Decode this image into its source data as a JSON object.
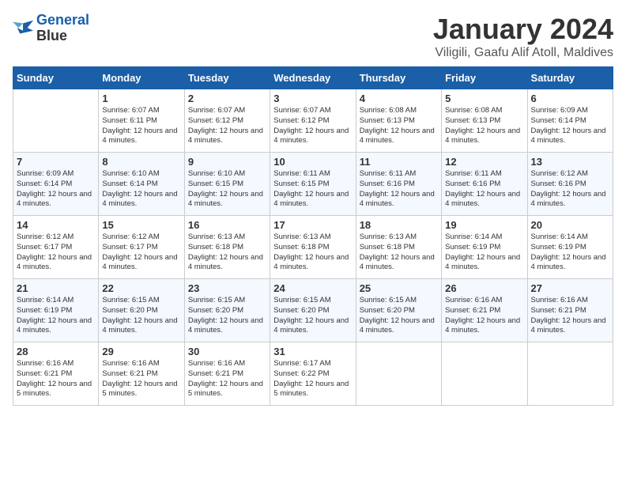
{
  "header": {
    "logo_line1": "General",
    "logo_line2": "Blue",
    "month": "January 2024",
    "location": "Viligili, Gaafu Alif Atoll, Maldives"
  },
  "days_of_week": [
    "Sunday",
    "Monday",
    "Tuesday",
    "Wednesday",
    "Thursday",
    "Friday",
    "Saturday"
  ],
  "weeks": [
    [
      {
        "day": "",
        "sunrise": "",
        "sunset": "",
        "daylight": ""
      },
      {
        "day": "1",
        "sunrise": "Sunrise: 6:07 AM",
        "sunset": "Sunset: 6:11 PM",
        "daylight": "Daylight: 12 hours and 4 minutes."
      },
      {
        "day": "2",
        "sunrise": "Sunrise: 6:07 AM",
        "sunset": "Sunset: 6:12 PM",
        "daylight": "Daylight: 12 hours and 4 minutes."
      },
      {
        "day": "3",
        "sunrise": "Sunrise: 6:07 AM",
        "sunset": "Sunset: 6:12 PM",
        "daylight": "Daylight: 12 hours and 4 minutes."
      },
      {
        "day": "4",
        "sunrise": "Sunrise: 6:08 AM",
        "sunset": "Sunset: 6:13 PM",
        "daylight": "Daylight: 12 hours and 4 minutes."
      },
      {
        "day": "5",
        "sunrise": "Sunrise: 6:08 AM",
        "sunset": "Sunset: 6:13 PM",
        "daylight": "Daylight: 12 hours and 4 minutes."
      },
      {
        "day": "6",
        "sunrise": "Sunrise: 6:09 AM",
        "sunset": "Sunset: 6:14 PM",
        "daylight": "Daylight: 12 hours and 4 minutes."
      }
    ],
    [
      {
        "day": "7",
        "sunrise": "Sunrise: 6:09 AM",
        "sunset": "Sunset: 6:14 PM",
        "daylight": "Daylight: 12 hours and 4 minutes."
      },
      {
        "day": "8",
        "sunrise": "Sunrise: 6:10 AM",
        "sunset": "Sunset: 6:14 PM",
        "daylight": "Daylight: 12 hours and 4 minutes."
      },
      {
        "day": "9",
        "sunrise": "Sunrise: 6:10 AM",
        "sunset": "Sunset: 6:15 PM",
        "daylight": "Daylight: 12 hours and 4 minutes."
      },
      {
        "day": "10",
        "sunrise": "Sunrise: 6:11 AM",
        "sunset": "Sunset: 6:15 PM",
        "daylight": "Daylight: 12 hours and 4 minutes."
      },
      {
        "day": "11",
        "sunrise": "Sunrise: 6:11 AM",
        "sunset": "Sunset: 6:16 PM",
        "daylight": "Daylight: 12 hours and 4 minutes."
      },
      {
        "day": "12",
        "sunrise": "Sunrise: 6:11 AM",
        "sunset": "Sunset: 6:16 PM",
        "daylight": "Daylight: 12 hours and 4 minutes."
      },
      {
        "day": "13",
        "sunrise": "Sunrise: 6:12 AM",
        "sunset": "Sunset: 6:16 PM",
        "daylight": "Daylight: 12 hours and 4 minutes."
      }
    ],
    [
      {
        "day": "14",
        "sunrise": "Sunrise: 6:12 AM",
        "sunset": "Sunset: 6:17 PM",
        "daylight": "Daylight: 12 hours and 4 minutes."
      },
      {
        "day": "15",
        "sunrise": "Sunrise: 6:12 AM",
        "sunset": "Sunset: 6:17 PM",
        "daylight": "Daylight: 12 hours and 4 minutes."
      },
      {
        "day": "16",
        "sunrise": "Sunrise: 6:13 AM",
        "sunset": "Sunset: 6:18 PM",
        "daylight": "Daylight: 12 hours and 4 minutes."
      },
      {
        "day": "17",
        "sunrise": "Sunrise: 6:13 AM",
        "sunset": "Sunset: 6:18 PM",
        "daylight": "Daylight: 12 hours and 4 minutes."
      },
      {
        "day": "18",
        "sunrise": "Sunrise: 6:13 AM",
        "sunset": "Sunset: 6:18 PM",
        "daylight": "Daylight: 12 hours and 4 minutes."
      },
      {
        "day": "19",
        "sunrise": "Sunrise: 6:14 AM",
        "sunset": "Sunset: 6:19 PM",
        "daylight": "Daylight: 12 hours and 4 minutes."
      },
      {
        "day": "20",
        "sunrise": "Sunrise: 6:14 AM",
        "sunset": "Sunset: 6:19 PM",
        "daylight": "Daylight: 12 hours and 4 minutes."
      }
    ],
    [
      {
        "day": "21",
        "sunrise": "Sunrise: 6:14 AM",
        "sunset": "Sunset: 6:19 PM",
        "daylight": "Daylight: 12 hours and 4 minutes."
      },
      {
        "day": "22",
        "sunrise": "Sunrise: 6:15 AM",
        "sunset": "Sunset: 6:20 PM",
        "daylight": "Daylight: 12 hours and 4 minutes."
      },
      {
        "day": "23",
        "sunrise": "Sunrise: 6:15 AM",
        "sunset": "Sunset: 6:20 PM",
        "daylight": "Daylight: 12 hours and 4 minutes."
      },
      {
        "day": "24",
        "sunrise": "Sunrise: 6:15 AM",
        "sunset": "Sunset: 6:20 PM",
        "daylight": "Daylight: 12 hours and 4 minutes."
      },
      {
        "day": "25",
        "sunrise": "Sunrise: 6:15 AM",
        "sunset": "Sunset: 6:20 PM",
        "daylight": "Daylight: 12 hours and 4 minutes."
      },
      {
        "day": "26",
        "sunrise": "Sunrise: 6:16 AM",
        "sunset": "Sunset: 6:21 PM",
        "daylight": "Daylight: 12 hours and 4 minutes."
      },
      {
        "day": "27",
        "sunrise": "Sunrise: 6:16 AM",
        "sunset": "Sunset: 6:21 PM",
        "daylight": "Daylight: 12 hours and 4 minutes."
      }
    ],
    [
      {
        "day": "28",
        "sunrise": "Sunrise: 6:16 AM",
        "sunset": "Sunset: 6:21 PM",
        "daylight": "Daylight: 12 hours and 5 minutes."
      },
      {
        "day": "29",
        "sunrise": "Sunrise: 6:16 AM",
        "sunset": "Sunset: 6:21 PM",
        "daylight": "Daylight: 12 hours and 5 minutes."
      },
      {
        "day": "30",
        "sunrise": "Sunrise: 6:16 AM",
        "sunset": "Sunset: 6:21 PM",
        "daylight": "Daylight: 12 hours and 5 minutes."
      },
      {
        "day": "31",
        "sunrise": "Sunrise: 6:17 AM",
        "sunset": "Sunset: 6:22 PM",
        "daylight": "Daylight: 12 hours and 5 minutes."
      },
      {
        "day": "",
        "sunrise": "",
        "sunset": "",
        "daylight": ""
      },
      {
        "day": "",
        "sunrise": "",
        "sunset": "",
        "daylight": ""
      },
      {
        "day": "",
        "sunrise": "",
        "sunset": "",
        "daylight": ""
      }
    ]
  ]
}
